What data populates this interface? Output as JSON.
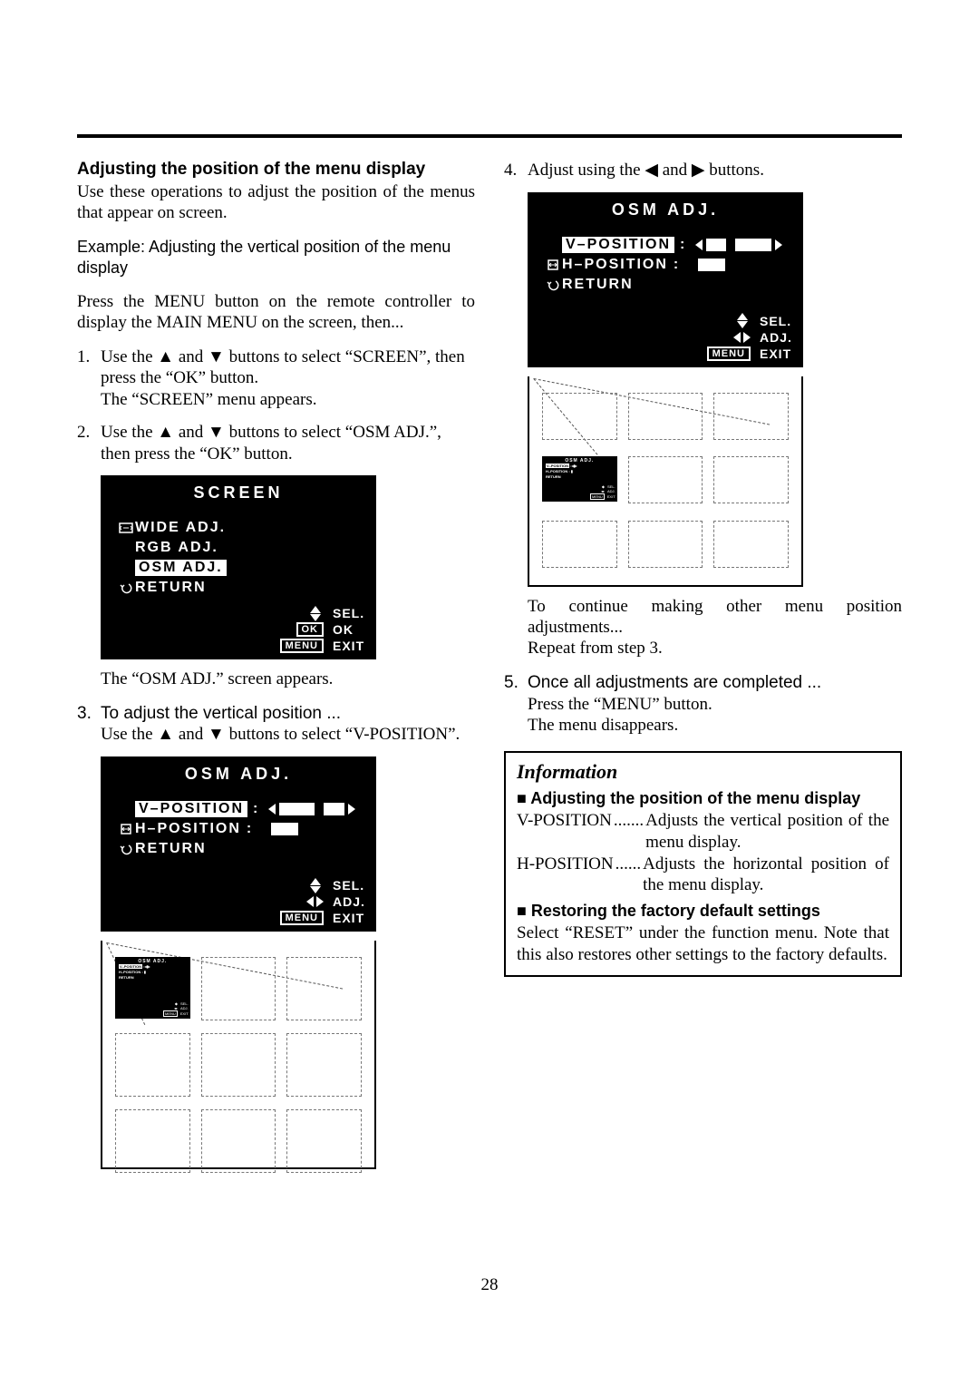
{
  "page_number": "28",
  "left": {
    "heading": "Adjusting the position of the menu display",
    "intro": "Use these operations to adjust the position of the menus that appear on screen.",
    "example": "Example: Adjusting the vertical position of the menu display",
    "press_menu": "Press the MENU button on the remote controller to display the MAIN MENU on the screen, then...",
    "step1_num": "1.",
    "step1_a": "Use the ",
    "step1_b": " and ",
    "step1_c": " buttons to select “SCREEN”, then press the “OK” button.",
    "step1_d": "The “SCREEN” menu appears.",
    "step2_num": "2.",
    "step2_a": "Use the ",
    "step2_b": " and ",
    "step2_c": " buttons to select “OSM ADJ.”, then press the “OK” button.",
    "after_screen": "The “OSM ADJ.” screen appears.",
    "step3_num": "3.",
    "step3_lead": "To adjust the vertical position ...",
    "step3_a": "Use the ",
    "step3_b": " and ",
    "step3_c": " buttons to select “V-POSITION”.",
    "btn_s": "▲",
    "btn_t": "▼"
  },
  "right": {
    "step4_num": "4.",
    "step4_a": "Adjust using the ",
    "step4_b": " and ",
    "step4_c": " buttons.",
    "btn_l": "◀",
    "btn_r": "▶",
    "after4_a": "To continue making other menu position adjustments...",
    "after4_b": "Repeat from step 3.",
    "step5_num": "5.",
    "step5_lead": "Once all adjustments are completed ...",
    "step5_a": "Press the “MENU” button.",
    "step5_b": "The menu disappears."
  },
  "screen_osd": {
    "title": "SCREEN",
    "items": [
      "WIDE ADJ.",
      "RGB ADJ.",
      "OSM ADJ.",
      "RETURN"
    ],
    "selected_index": 2,
    "hints": {
      "sel": "SEL.",
      "ok_icon": "OK",
      "ok": "OK",
      "menu_icon": "MENU",
      "exit": "EXIT"
    }
  },
  "osm_osd": {
    "title": "OSM ADJ.",
    "items": [
      "V–POSITION",
      "H–POSITION",
      "RETURN"
    ],
    "selected_index": 0,
    "hints": {
      "sel": "SEL.",
      "adj": "ADJ.",
      "menu_icon": "MENU",
      "exit": "EXIT"
    }
  },
  "osm_left_knob_pct": 62,
  "osm_right_knob_pct": 35,
  "info": {
    "title": "Information",
    "h1_pref": "■ ",
    "h1": "Adjusting the position of the menu display",
    "r1_k": "V-POSITION",
    "r1_dots": ".......",
    "r1_v": "Adjusts the vertical position of the menu display.",
    "r2_k": "H-POSITION",
    "r2_dots": "......",
    "r2_v": "Adjusts the horizontal position of the menu display.",
    "h2_pref": "■ ",
    "h2": "Restoring the factory default settings",
    "p2": "Select “RESET” under the function menu. Note that this also restores other settings to the factory defaults."
  }
}
